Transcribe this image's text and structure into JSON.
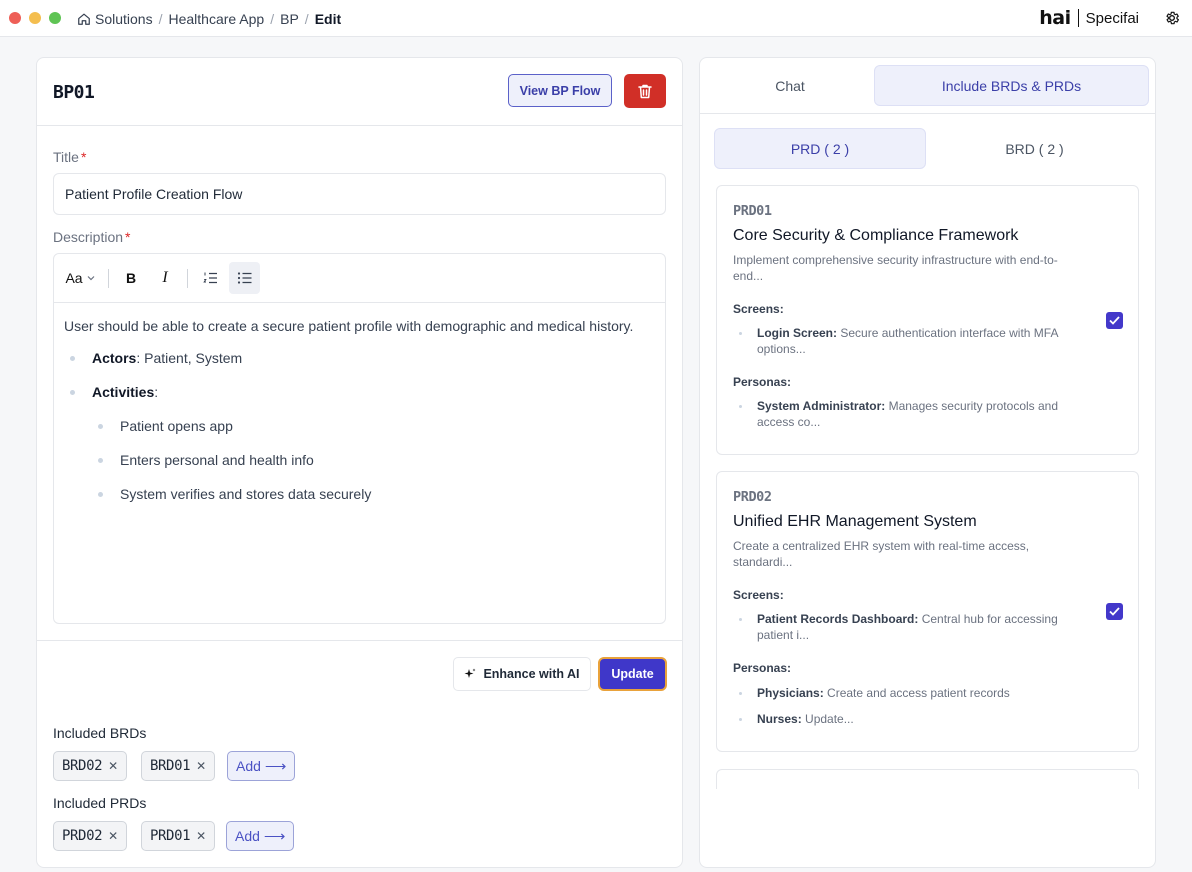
{
  "breadcrumb": [
    "Solutions",
    "Healthcare App",
    "BP",
    "Edit"
  ],
  "brand": {
    "logo": "hai",
    "name": "Specifai"
  },
  "bp": {
    "id": "BP01",
    "view_flow_label": "View BP Flow",
    "title_label": "Title",
    "title_value": "Patient Profile Creation Flow",
    "description_label": "Description",
    "required_mark": "*",
    "toolbar": {
      "font_label": "Aa",
      "bold": "B",
      "italic": "I"
    },
    "description": {
      "intro": "User should be able to create a secure patient profile with demographic and medical history.",
      "actors_label": "Actors",
      "actors_value": ": Patient, System",
      "activities_label": "Activities",
      "activities_colon": ":",
      "activities": [
        "Patient opens app",
        "Enters personal and health info",
        "System verifies and stores data securely"
      ]
    },
    "enhance_label": "Enhance with AI",
    "update_label": "Update",
    "included_brds_label": "Included BRDs",
    "included_brds": [
      "BRD02",
      "BRD01"
    ],
    "included_prds_label": "Included PRDs",
    "included_prds": [
      "PRD02",
      "PRD01"
    ],
    "add_label": "Add",
    "remove_glyph": "✕"
  },
  "right": {
    "tabs": [
      "Chat",
      "Include BRDs & PRDs"
    ],
    "active_tab": 1,
    "subtabs": [
      "PRD ( 2 )",
      "BRD ( 2 )"
    ],
    "active_subtab": 0,
    "screens_label": "Screens:",
    "personas_label": "Personas:",
    "prds": [
      {
        "id": "PRD01",
        "title": "Core Security & Compliance Framework",
        "desc": "Implement comprehensive security infrastructure with end-to-end...",
        "screens": [
          {
            "name": "Login Screen:",
            "text": " Secure authentication interface with MFA options..."
          }
        ],
        "personas": [
          {
            "name": "System Administrator:",
            "text": " Manages security protocols and access co..."
          }
        ],
        "checked": true
      },
      {
        "id": "PRD02",
        "title": "Unified EHR Management System",
        "desc": "Create a centralized EHR system with real-time access, standardi...",
        "screens": [
          {
            "name": "Patient Records Dashboard:",
            "text": " Central hub for accessing patient i..."
          }
        ],
        "personas": [
          {
            "name": "Physicians:",
            "text": " Create and access patient records"
          },
          {
            "name": "Nurses:",
            "text": " Update..."
          }
        ],
        "checked": true
      }
    ]
  },
  "colors": {
    "accent": "#3f37c9",
    "danger": "#d12f27",
    "focus_ring": "#e9a23b"
  }
}
